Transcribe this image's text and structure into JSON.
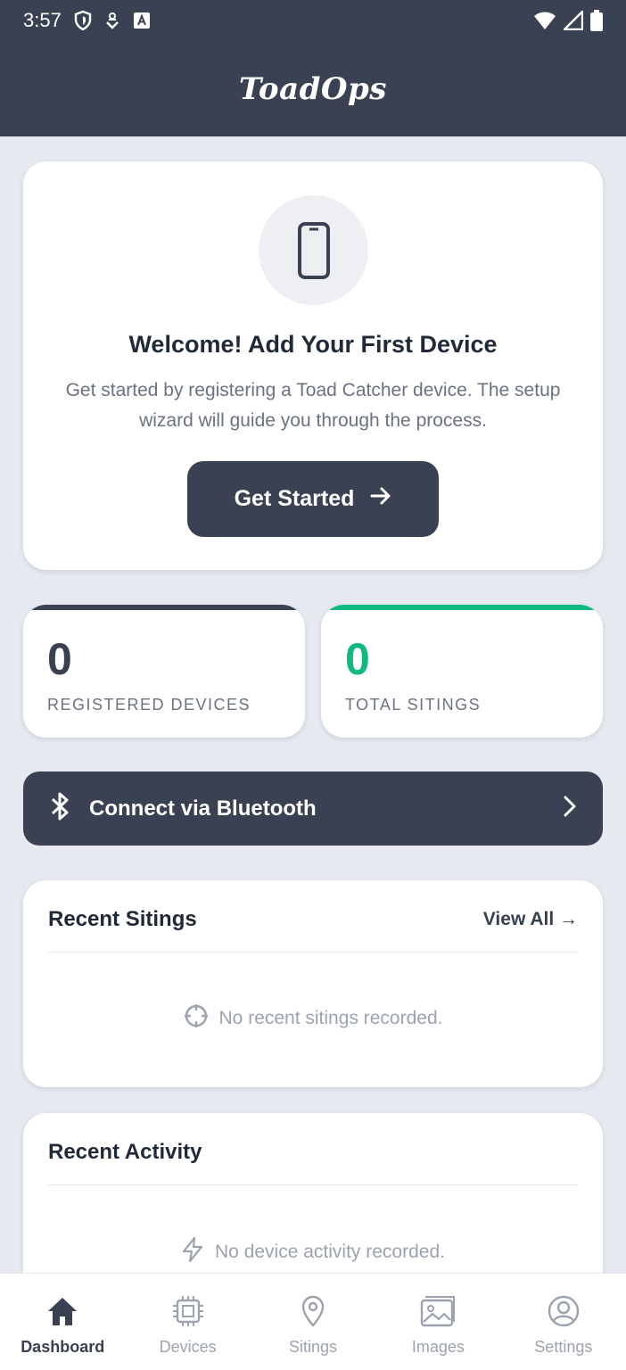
{
  "status_bar": {
    "time": "3:57"
  },
  "app": {
    "title": "ToadOps"
  },
  "welcome": {
    "title": "Welcome! Add Your First Device",
    "description": "Get started by registering a Toad Catcher device. The setup wizard will guide you through the process.",
    "button_label": "Get Started"
  },
  "stats": [
    {
      "value": "0",
      "label": "REGISTERED DEVICES",
      "color": "#394152"
    },
    {
      "value": "0",
      "label": "TOTAL SITINGS",
      "color": "#10b981"
    }
  ],
  "bluetooth": {
    "label": "Connect via Bluetooth"
  },
  "recent_sitings": {
    "title": "Recent Sitings",
    "view_all": "View All →",
    "empty_text": "No recent sitings recorded."
  },
  "recent_activity": {
    "title": "Recent Activity",
    "empty_text": "No device activity recorded."
  },
  "nav": [
    {
      "label": "Dashboard",
      "icon": "home-icon",
      "active": true
    },
    {
      "label": "Devices",
      "icon": "chip-icon",
      "active": false
    },
    {
      "label": "Sitings",
      "icon": "map-pin-icon",
      "active": false
    },
    {
      "label": "Images",
      "icon": "image-icon",
      "active": false
    },
    {
      "label": "Settings",
      "icon": "user-circle-icon",
      "active": false
    }
  ],
  "colors": {
    "primary": "#394152",
    "accent": "#10b981",
    "background": "#e6e9f0"
  }
}
